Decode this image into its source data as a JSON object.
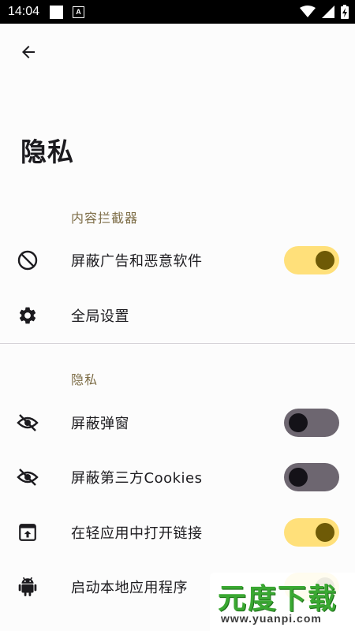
{
  "status_bar": {
    "time": "14:04",
    "notification_letter": "A",
    "icons": [
      "wifi-icon",
      "signal-icon",
      "battery-icon"
    ]
  },
  "header": {
    "back_icon": "arrow-left-icon",
    "title": "隐私"
  },
  "sections": {
    "content_blocker": {
      "header": "内容拦截器",
      "items": [
        {
          "label": "屏蔽广告和恶意软件",
          "icon": "block-icon",
          "toggle": true
        },
        {
          "label": "全局设置",
          "icon": "gear-icon"
        }
      ]
    },
    "privacy": {
      "header": "隐私",
      "items": [
        {
          "label": "屏蔽弹窗",
          "icon": "eye-off-icon",
          "toggle": false
        },
        {
          "label": "屏蔽第三方Cookies",
          "icon": "eye-off-icon",
          "toggle": false
        },
        {
          "label": "在轻应用中打开链接",
          "icon": "open-in-app-icon",
          "toggle": true
        },
        {
          "label": "启动本地应用程序",
          "icon": "android-icon",
          "toggle": true
        }
      ]
    }
  },
  "watermark": {
    "title": "元度下载",
    "url": "www.yuanpi.com"
  },
  "colors": {
    "accent": "#7d6d47",
    "switch_on_track": "#ffe07a",
    "switch_on_thumb": "#6e5a06",
    "switch_off_track": "#6d6670",
    "switch_off_thumb": "#141218",
    "watermark_green": "#3aa832"
  }
}
